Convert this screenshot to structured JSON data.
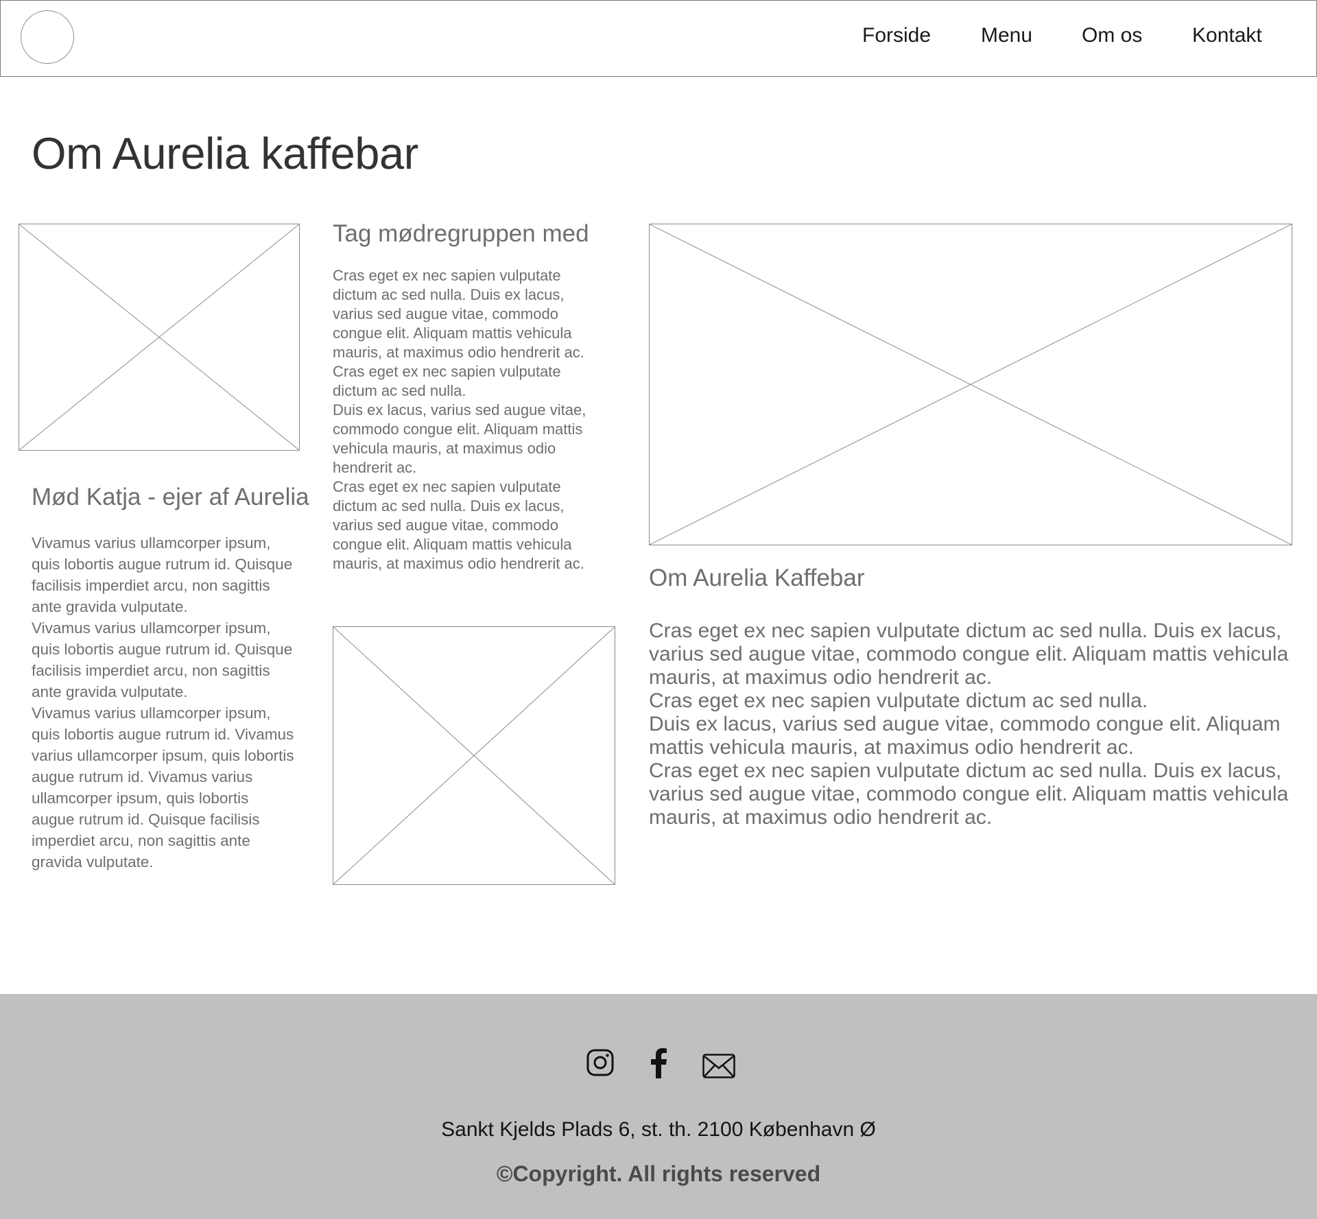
{
  "header": {
    "logo": "logo-circle-placeholder",
    "nav": [
      "Forside",
      "Menu",
      "Om os",
      "Kontakt"
    ]
  },
  "page": {
    "title": "Om Aurelia kaffebar"
  },
  "katja": {
    "heading": "Mød Katja - ejer af Aurelia",
    "lines": [
      "Vivamus varius ullamcorper ipsum,",
      "quis lobortis augue rutrum id. Quisque",
      "facilisis imperdiet arcu, non sagittis",
      "ante gravida vulputate.",
      "Vivamus varius ullamcorper ipsum,",
      "quis lobortis augue rutrum id. Quisque",
      "facilisis imperdiet arcu, non sagittis",
      "ante gravida vulputate.",
      "Vivamus varius ullamcorper ipsum,",
      "quis lobortis augue rutrum id. Vivamus",
      "varius ullamcorper ipsum, quis lobortis",
      "augue rutrum id. Vivamus varius",
      "ullamcorper ipsum, quis lobortis",
      "augue rutrum id. Quisque facilisis",
      "imperdiet arcu, non sagittis ante",
      "gravida vulputate."
    ]
  },
  "moedregruppe": {
    "heading": "Tag mødregruppen med",
    "lines": [
      "Cras eget ex nec sapien vulputate",
      "dictum ac sed nulla. Duis ex lacus,",
      "varius sed augue vitae, commodo",
      "congue elit. Aliquam mattis vehicula",
      "mauris, at maximus odio hendrerit ac.",
      "Cras eget ex nec sapien vulputate",
      "dictum ac sed nulla.",
      "Duis ex lacus, varius sed augue vitae,",
      "commodo congue elit. Aliquam mattis",
      "vehicula mauris, at maximus odio",
      "hendrerit ac.",
      "Cras eget ex nec sapien vulputate",
      "dictum ac sed nulla. Duis ex lacus,",
      "varius sed augue vitae, commodo",
      "congue elit. Aliquam mattis vehicula",
      "mauris, at maximus odio hendrerit ac."
    ]
  },
  "about": {
    "heading": "Om Aurelia Kaffebar",
    "lines": [
      "Cras eget ex nec sapien vulputate dictum ac sed nulla. Duis ex lacus,",
      "varius sed augue vitae, commodo congue elit. Aliquam mattis vehicula",
      "mauris, at maximus odio hendrerit ac.",
      "Cras eget ex nec sapien vulputate dictum ac sed nulla.",
      "Duis ex lacus, varius sed augue vitae, commodo congue elit. Aliquam",
      "mattis vehicula mauris, at maximus odio hendrerit ac.",
      "Cras eget ex nec sapien vulputate dictum ac sed nulla. Duis ex lacus,",
      "varius sed augue vitae, commodo congue elit. Aliquam mattis vehicula",
      "mauris, at maximus odio hendrerit ac."
    ]
  },
  "placeholders": [
    "image-placeholder",
    "image-placeholder",
    "image-placeholder"
  ],
  "footer": {
    "social_icons": [
      "instagram-icon",
      "facebook-icon",
      "mail-icon"
    ],
    "address": "Sankt Kjelds Plads 6, st. th. 2100 København Ø",
    "copyright": "©Copyright. All rights reserved"
  }
}
